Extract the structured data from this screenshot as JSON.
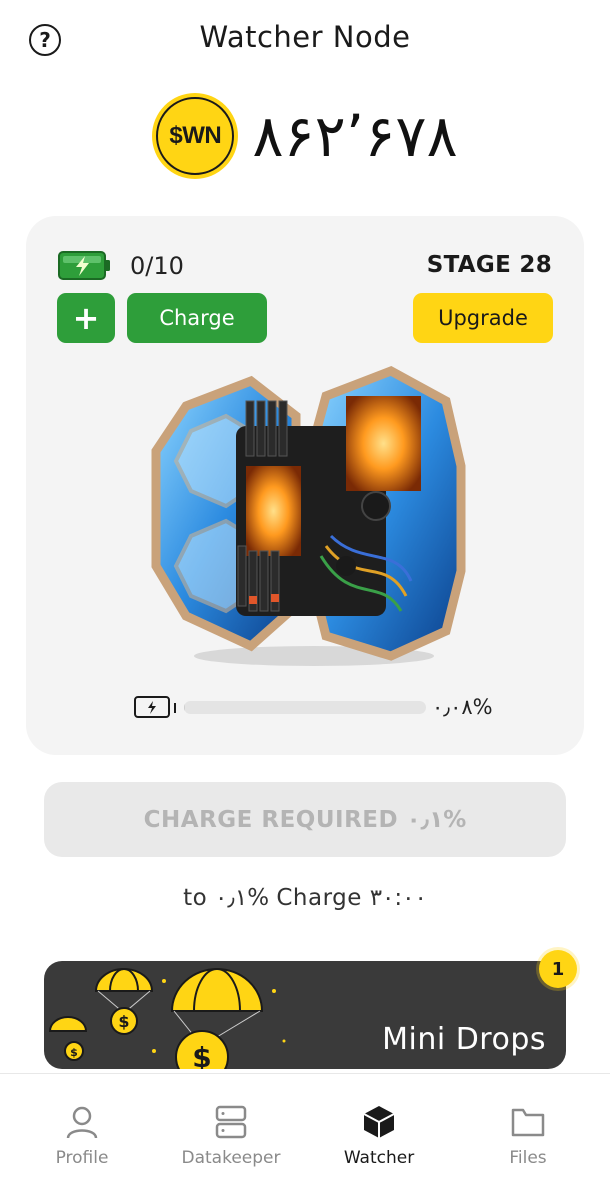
{
  "header": {
    "title": "Watcher Node",
    "help_icon": "question-circle-icon"
  },
  "balance": {
    "coin_label": "$WN",
    "value": "۸۶۲٬۶۷۸"
  },
  "node_card": {
    "battery_count": "0/10",
    "stage": "STAGE 28",
    "plus_label": "+",
    "charge_label": "Charge",
    "upgrade_label": "Upgrade",
    "progress_percent": "۰٫۰۸%",
    "progress_fraction": 0.0008,
    "image_icon": "watcher-node-hardware-image"
  },
  "charge_required": {
    "label": "CHARGE REQUIRED ۰٫۱%"
  },
  "timer": {
    "text": "to ۰٫۱% Charge ۳۰:۰۰"
  },
  "mini_drops": {
    "label": "Mini Drops",
    "badge_count": "1"
  },
  "bottom_nav": {
    "items": [
      {
        "label": "Profile",
        "icon": "user-icon"
      },
      {
        "label": "Datakeeper",
        "icon": "server-icon"
      },
      {
        "label": "Watcher",
        "icon": "cube-icon",
        "active": true
      },
      {
        "label": "Files",
        "icon": "folder-icon"
      }
    ]
  },
  "colors": {
    "accent_yellow": "#ffd514",
    "button_green": "#2e9e3a",
    "card_bg": "#f4f4f4",
    "disabled_text": "#b4b4b4",
    "mini_drops_bg": "#3a3a3a"
  }
}
